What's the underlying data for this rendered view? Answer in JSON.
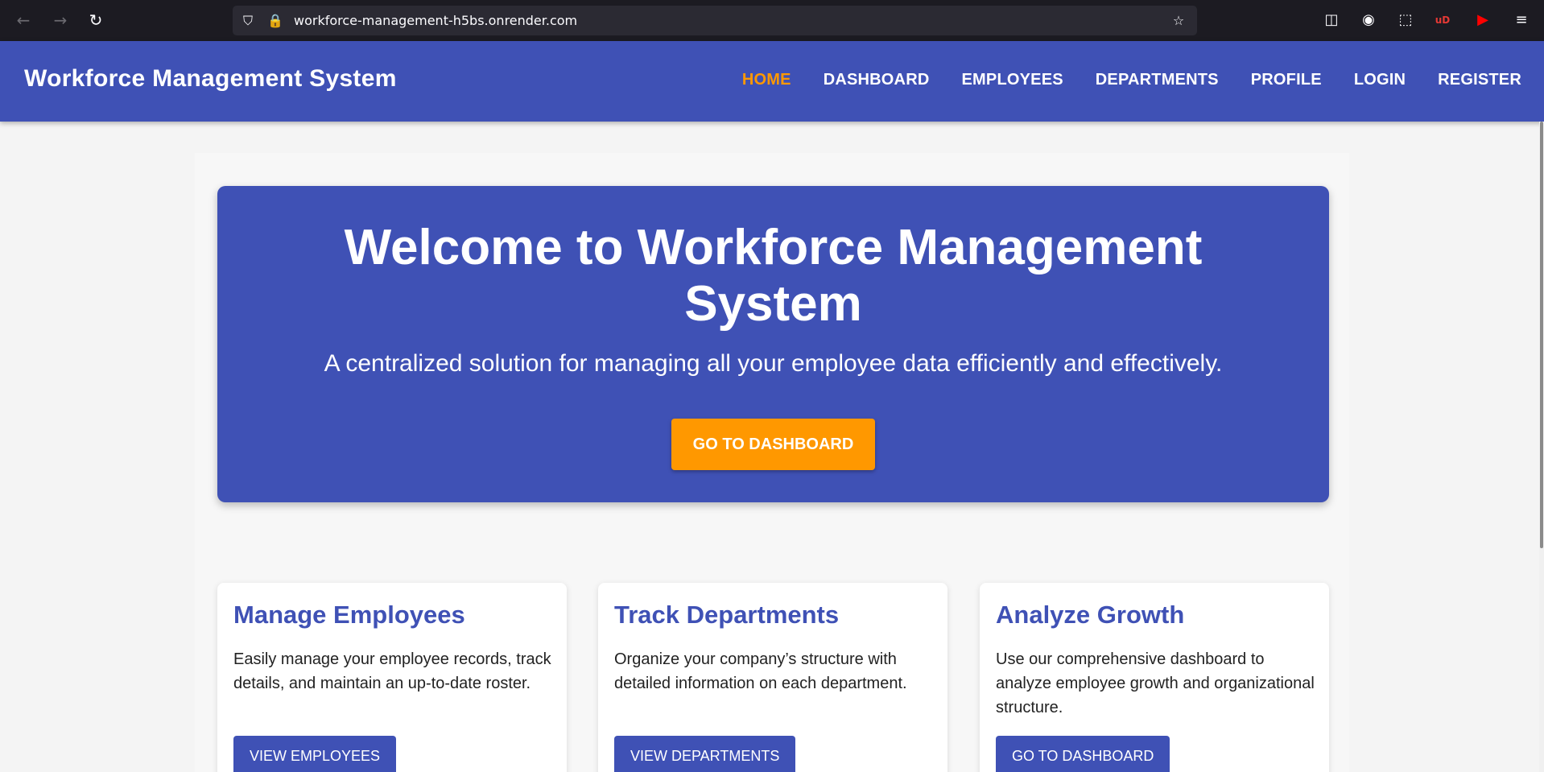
{
  "browser": {
    "url": "workforce-management-h5bs.onrender.com",
    "back_icon": "←",
    "forward_icon": "→",
    "reload_icon": "↻",
    "shield_icon": "⛉",
    "lock_icon": "🔒",
    "star_icon": "☆",
    "pocket_icon": "◫",
    "account_icon": "◉",
    "extensions_icon": "⬚",
    "ublock_icon": "uD",
    "youtube_icon": "▶",
    "menu_icon": "≡"
  },
  "site": {
    "brand": "Workforce Management System",
    "nav": [
      "HOME",
      "DASHBOARD",
      "EMPLOYEES",
      "DEPARTMENTS",
      "PROFILE",
      "LOGIN",
      "REGISTER"
    ],
    "active_nav": "HOME"
  },
  "hero": {
    "title": "Welcome to Workforce Management System",
    "subtitle": "A centralized solution for managing all your employee data efficiently and effectively.",
    "button": "GO TO DASHBOARD"
  },
  "cards": [
    {
      "title": "Manage Employees",
      "text": "Easily manage your employee records, track details, and maintain an up-to-date roster.",
      "button": "VIEW EMPLOYEES"
    },
    {
      "title": "Track Departments",
      "text": "Organize your company’s structure with detailed information on each department.",
      "button": "VIEW DEPARTMENTS"
    },
    {
      "title": "Analyze Growth",
      "text": "Use our comprehensive dashboard to analyze employee growth and organizational structure.",
      "button": "GO TO DASHBOARD"
    }
  ],
  "colors": {
    "primary": "#3f51b5",
    "accent": "#ff9800",
    "browser_bg": "#1c1b22"
  }
}
